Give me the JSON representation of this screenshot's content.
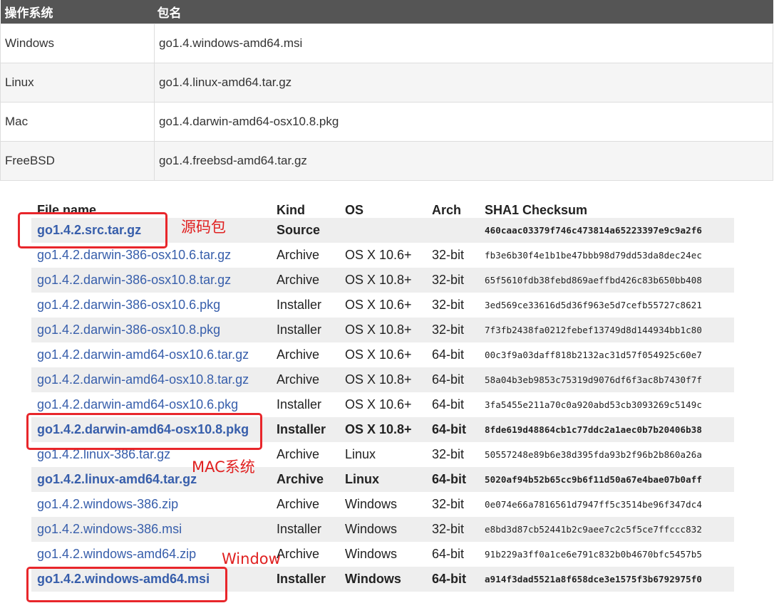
{
  "top_table": {
    "headers": [
      "操作系统",
      "包名"
    ],
    "rows": [
      {
        "os": "Windows",
        "pkg": "go1.4.windows-amd64.msi"
      },
      {
        "os": "Linux",
        "pkg": "go1.4.linux-amd64.tar.gz"
      },
      {
        "os": "Mac",
        "pkg": "go1.4.darwin-amd64-osx10.8.pkg"
      },
      {
        "os": "FreeBSD",
        "pkg": "go1.4.freebsd-amd64.tar.gz"
      }
    ]
  },
  "downloads": {
    "headers": [
      "File name",
      "Kind",
      "OS",
      "Arch",
      "SHA1 Checksum"
    ],
    "rows": [
      {
        "file": "go1.4.2.src.tar.gz",
        "kind": "Source",
        "os": "",
        "arch": "",
        "sha": "460caac03379f746c473814a65223397e9c9a2f6"
      },
      {
        "file": "go1.4.2.darwin-386-osx10.6.tar.gz",
        "kind": "Archive",
        "os": "OS X 10.6+",
        "arch": "32-bit",
        "sha": "fb3e6b30f4e1b1be47bbb98d79dd53da8dec24ec"
      },
      {
        "file": "go1.4.2.darwin-386-osx10.8.tar.gz",
        "kind": "Archive",
        "os": "OS X 10.8+",
        "arch": "32-bit",
        "sha": "65f5610fdb38febd869aeffbd426c83b650bb408"
      },
      {
        "file": "go1.4.2.darwin-386-osx10.6.pkg",
        "kind": "Installer",
        "os": "OS X 10.6+",
        "arch": "32-bit",
        "sha": "3ed569ce33616d5d36f963e5d7cefb55727c8621"
      },
      {
        "file": "go1.4.2.darwin-386-osx10.8.pkg",
        "kind": "Installer",
        "os": "OS X 10.8+",
        "arch": "32-bit",
        "sha": "7f3fb2438fa0212febef13749d8d144934bb1c80"
      },
      {
        "file": "go1.4.2.darwin-amd64-osx10.6.tar.gz",
        "kind": "Archive",
        "os": "OS X 10.6+",
        "arch": "64-bit",
        "sha": "00c3f9a03daff818b2132ac31d57f054925c60e7"
      },
      {
        "file": "go1.4.2.darwin-amd64-osx10.8.tar.gz",
        "kind": "Archive",
        "os": "OS X 10.8+",
        "arch": "64-bit",
        "sha": "58a04b3eb9853c75319d9076df6f3ac8b7430f7f"
      },
      {
        "file": "go1.4.2.darwin-amd64-osx10.6.pkg",
        "kind": "Installer",
        "os": "OS X 10.6+",
        "arch": "64-bit",
        "sha": "3fa5455e211a70c0a920abd53cb3093269c5149c"
      },
      {
        "file": "go1.4.2.darwin-amd64-osx10.8.pkg",
        "kind": "Installer",
        "os": "OS X 10.8+",
        "arch": "64-bit",
        "sha": "8fde619d48864cb1c77ddc2a1aec0b7b20406b38"
      },
      {
        "file": "go1.4.2.linux-386.tar.gz",
        "kind": "Archive",
        "os": "Linux",
        "arch": "32-bit",
        "sha": "50557248e89b6e38d395fda93b2f96b2b860a26a"
      },
      {
        "file": "go1.4.2.linux-amd64.tar.gz",
        "kind": "Archive",
        "os": "Linux",
        "arch": "64-bit",
        "sha": "5020af94b52b65cc9b6f11d50a67e4bae07b0aff"
      },
      {
        "file": "go1.4.2.windows-386.zip",
        "kind": "Archive",
        "os": "Windows",
        "arch": "32-bit",
        "sha": "0e074e66a7816561d7947ff5c3514be96f347dc4"
      },
      {
        "file": "go1.4.2.windows-386.msi",
        "kind": "Installer",
        "os": "Windows",
        "arch": "32-bit",
        "sha": "e8bd3d87cb52441b2c9aee7c2c5f5ce7ffccc832"
      },
      {
        "file": "go1.4.2.windows-amd64.zip",
        "kind": "Archive",
        "os": "Windows",
        "arch": "64-bit",
        "sha": "91b229a3ff0a1ce6e791c832b0b4670bfc5457b5"
      },
      {
        "file": "go1.4.2.windows-amd64.msi",
        "kind": "Installer",
        "os": "Windows",
        "arch": "64-bit",
        "sha": "a914f3dad5521a8f658dce3e1575f3b6792975f0"
      }
    ]
  },
  "annotations": {
    "source_note": "源码包",
    "mac_note": "MAC系统",
    "windows_note": "Window"
  },
  "colors": {
    "header_bg": "#555555",
    "link": "#375eab",
    "annotation_red": "#e8262b"
  }
}
